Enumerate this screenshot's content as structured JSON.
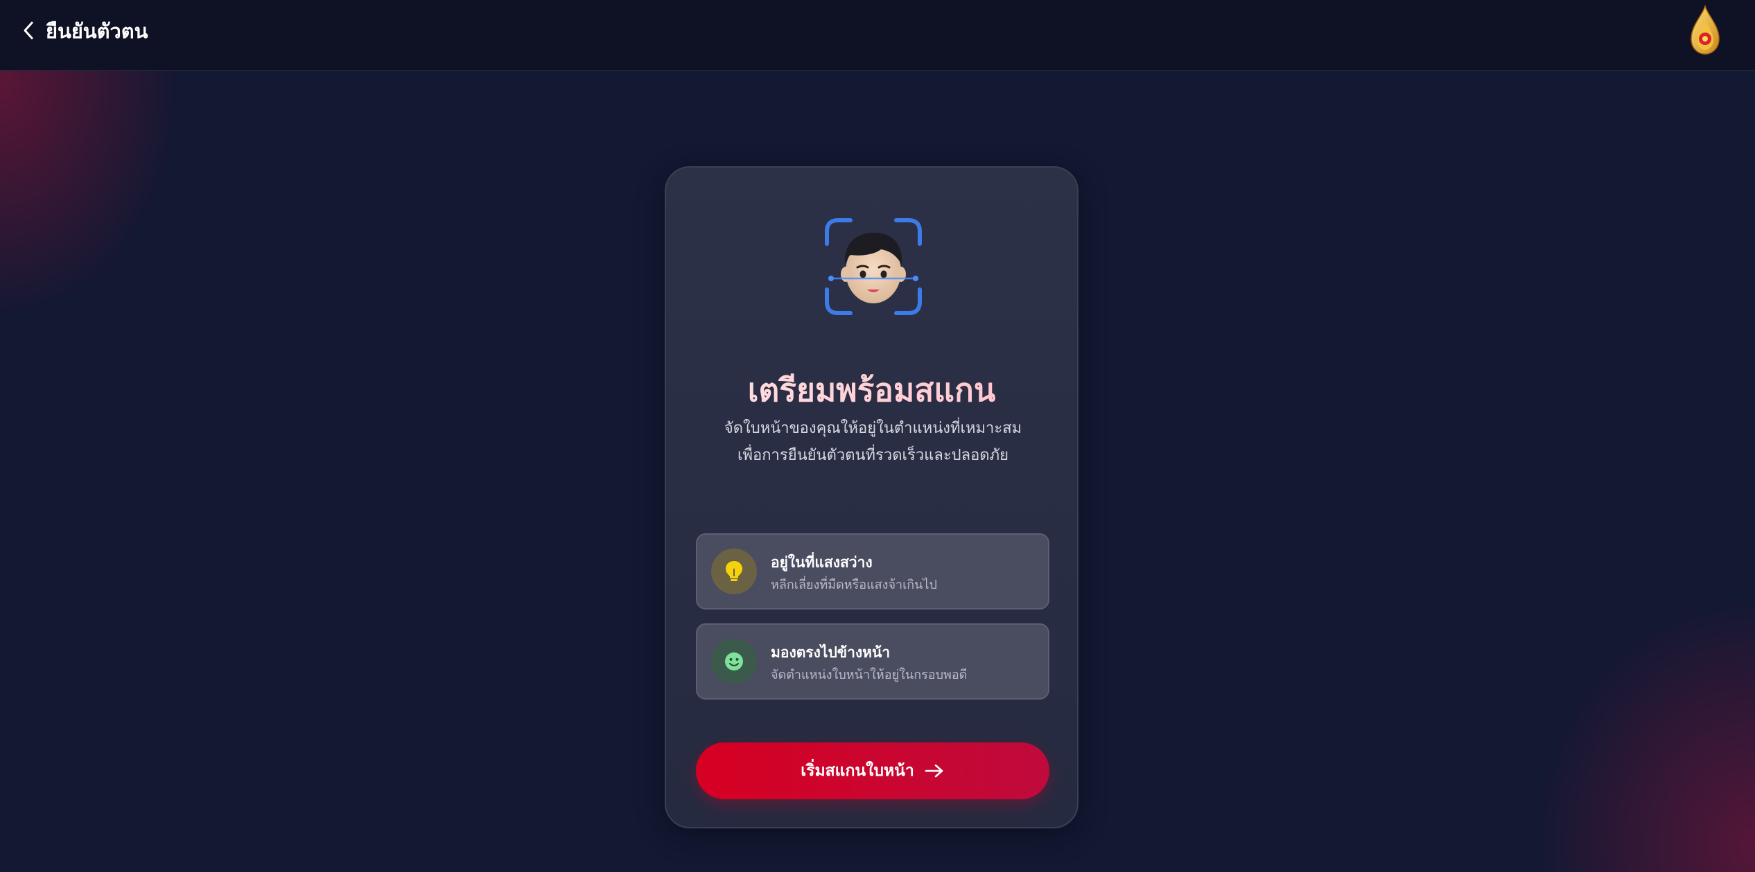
{
  "header": {
    "title": "ยืนยันตัวตน",
    "back_icon": "chevron-left-icon",
    "logo_icon": "royal-emblem-logo"
  },
  "card": {
    "illustration_icon": "face-scan-icon",
    "title": "เตรียมพร้อมสแกน",
    "description": "จัดใบหน้าของคุณให้อยู่ในตำแหน่งที่เหมาะสม เพื่อการยืนยันตัวตนที่รวดเร็วและปลอดภัย",
    "tips": [
      {
        "icon": "lightbulb-icon",
        "title": "อยู่ในที่แสงสว่าง",
        "subtitle": "หลีกเลี่ยงที่มืดหรือแสงจ้าเกินไป",
        "icon_color": "#f5d20a",
        "icon_bg": "#6b6243"
      },
      {
        "icon": "smile-icon",
        "title": "มองตรงไปข้างหน้า",
        "subtitle": "จัดตำแหน่งใบหน้าให้อยู่ในกรอบพอดี",
        "icon_color": "#7ee29a",
        "icon_bg": "#3c5a4c"
      }
    ],
    "start_button": {
      "label": "เริ่มสแกนใบหน้า",
      "icon": "arrow-right-icon",
      "color": "#d60022"
    }
  },
  "colors": {
    "background": "#131833",
    "header": "#0f1225",
    "card": "#2d3147",
    "accent": "#d60022"
  }
}
